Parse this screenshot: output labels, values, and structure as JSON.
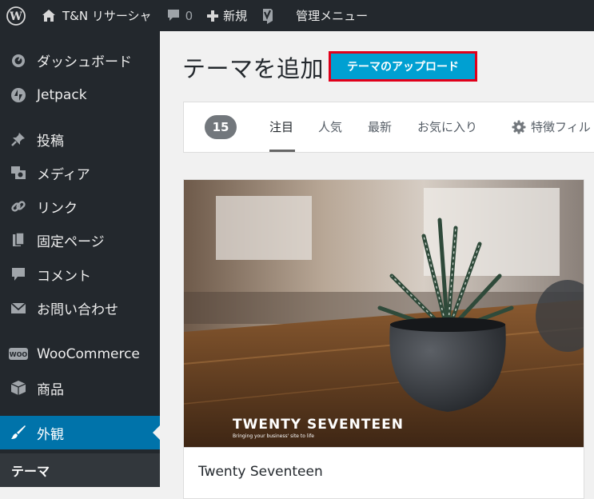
{
  "adminbar": {
    "site_name": "T&N リサーシャ",
    "comments_count": "0",
    "new_label": "新規",
    "menu_label": "管理メニュー"
  },
  "sidebar": {
    "items": [
      {
        "label": "ダッシュボード",
        "icon": "dashboard-icon"
      },
      {
        "label": "Jetpack",
        "icon": "jetpack-icon"
      },
      {
        "label": "投稿",
        "icon": "pin-icon"
      },
      {
        "label": "メディア",
        "icon": "media-icon"
      },
      {
        "label": "リンク",
        "icon": "link-icon"
      },
      {
        "label": "固定ページ",
        "icon": "page-icon"
      },
      {
        "label": "コメント",
        "icon": "comment-icon"
      },
      {
        "label": "お問い合わせ",
        "icon": "mail-icon"
      },
      {
        "label": "WooCommerce",
        "icon": "woo-icon"
      },
      {
        "label": "商品",
        "icon": "box-icon"
      },
      {
        "label": "外観",
        "icon": "brush-icon"
      }
    ],
    "active_sub": "テーマ",
    "active_color": "#0073aa"
  },
  "main": {
    "title": "テーマを追加",
    "upload_button": "テーマのアップロード",
    "theme_count": "15",
    "tabs": [
      "注目",
      "人気",
      "最新",
      "お気に入り"
    ],
    "feature_filter": "特徴フィル",
    "theme_card": {
      "screenshot_title": "TWENTY SEVENTEEN",
      "screenshot_subtitle": "Bringing your business' site to life",
      "name": "Twenty Seventeen"
    }
  }
}
